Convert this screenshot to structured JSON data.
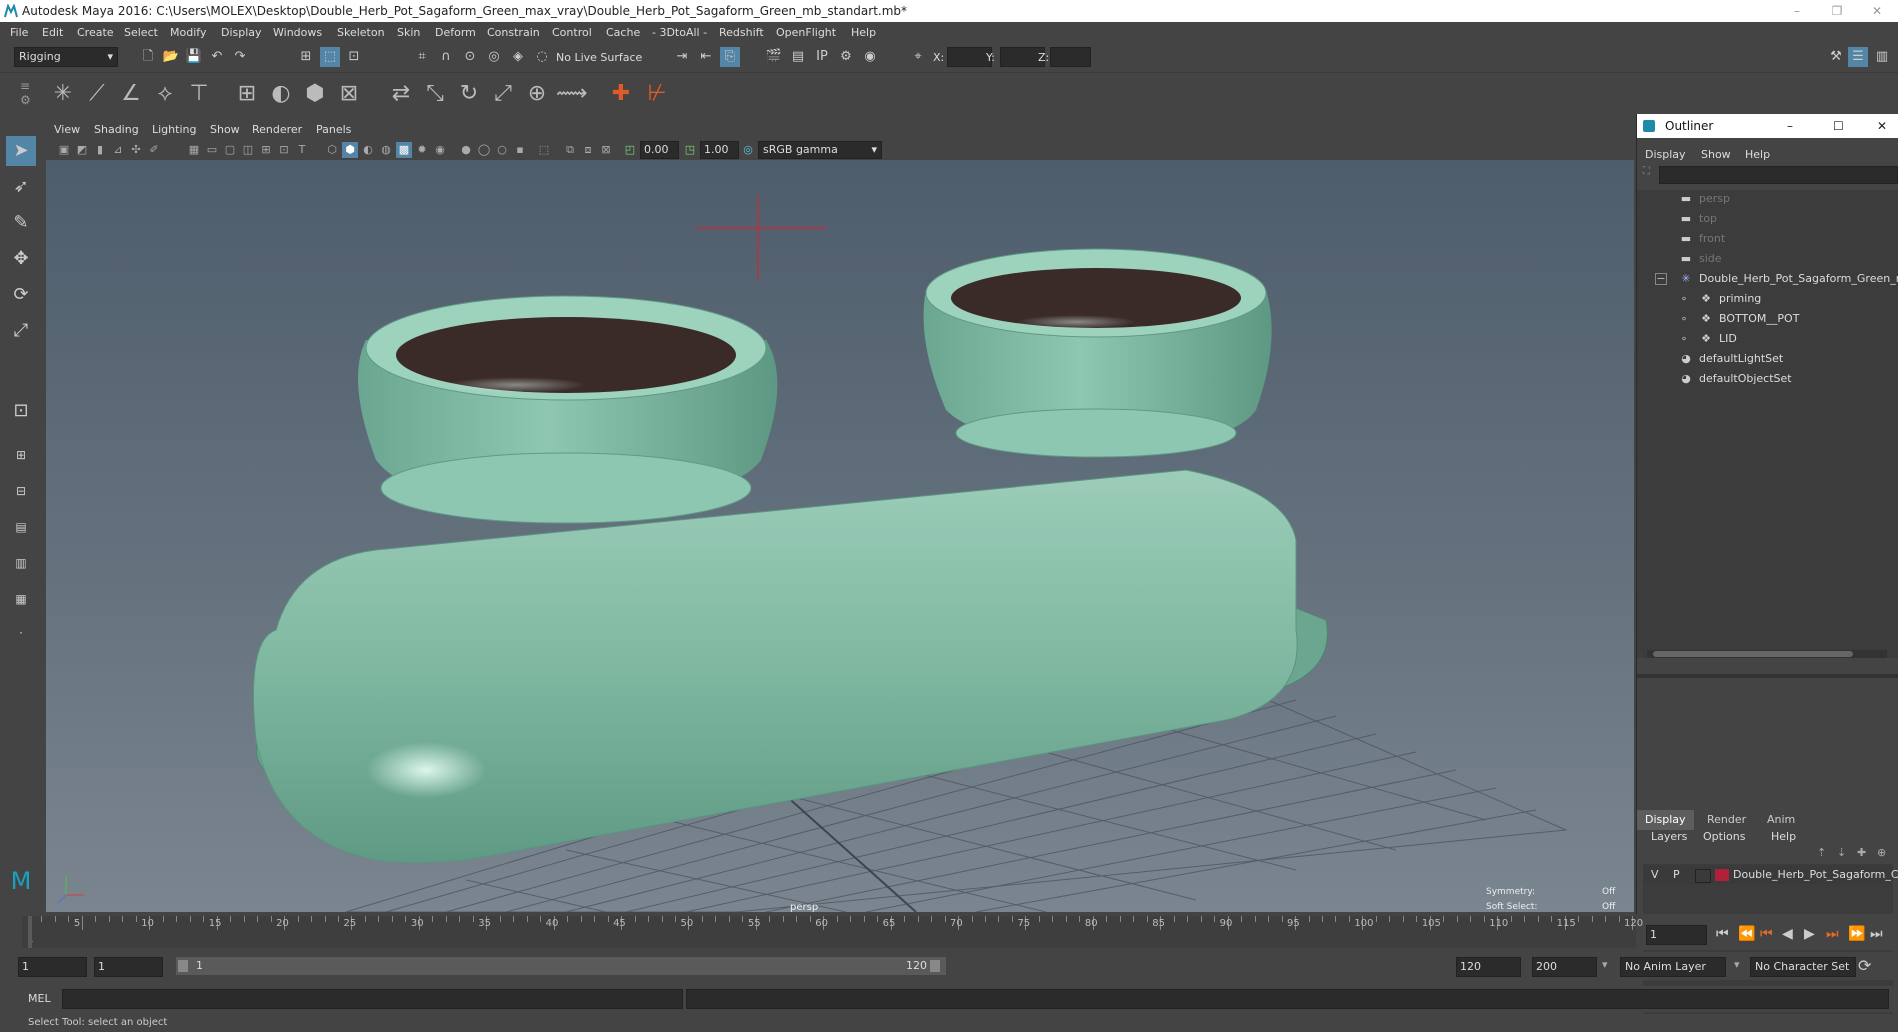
{
  "window": {
    "title": "Autodesk Maya 2016: C:\\Users\\MOLEX\\Desktop\\Double_Herb_Pot_Sagaform_Green_max_vray\\Double_Herb_Pot_Sagaform_Green_mb_standart.mb*",
    "minimize": "–",
    "restore": "❐",
    "close": "✕"
  },
  "menubar": [
    "File",
    "Edit",
    "Create",
    "Select",
    "Modify",
    "Display",
    "Windows",
    "Skeleton",
    "Skin",
    "Deform",
    "Constrain",
    "Control",
    "Cache",
    "- 3DtoAll -",
    "Redshift",
    "OpenFlight",
    "Help"
  ],
  "statusline": {
    "mode": "Rigging",
    "live_surface": "No Live Surface",
    "x_label": "X:",
    "y_label": "Y:",
    "z_label": "Z:"
  },
  "viewport": {
    "menus": [
      "View",
      "Shading",
      "Lighting",
      "Show",
      "Renderer",
      "Panels"
    ],
    "exposure": "0.00",
    "gamma": "1.00",
    "colorspace": "sRGB gamma",
    "camera_label": "persp",
    "symmetry_label": "Symmetry:",
    "symmetry_value": "Off",
    "soft_select_label": "Soft Select:",
    "soft_select_value": "Off"
  },
  "outliner": {
    "title": "Outliner",
    "menus": [
      "Display",
      "Show",
      "Help"
    ],
    "items": [
      {
        "label": "persp",
        "icon": "camera-icon",
        "indent": 0,
        "dim": true
      },
      {
        "label": "top",
        "icon": "camera-icon",
        "indent": 0,
        "dim": true
      },
      {
        "label": "front",
        "icon": "camera-icon",
        "indent": 0,
        "dim": true
      },
      {
        "label": "side",
        "icon": "camera-icon",
        "indent": 0,
        "dim": true
      },
      {
        "label": "Double_Herb_Pot_Sagaform_Green_r",
        "icon": "group-icon",
        "indent": 0,
        "dim": false,
        "expanded": true
      },
      {
        "label": "priming",
        "icon": "mesh-icon",
        "indent": 1,
        "dim": false
      },
      {
        "label": "BOTTOM__POT",
        "icon": "mesh-icon",
        "indent": 1,
        "dim": false
      },
      {
        "label": "LID",
        "icon": "mesh-icon",
        "indent": 1,
        "dim": false
      },
      {
        "label": "defaultLightSet",
        "icon": "set-icon",
        "indent": 0,
        "dim": false
      },
      {
        "label": "defaultObjectSet",
        "icon": "set-icon",
        "indent": 0,
        "dim": false
      }
    ]
  },
  "layer_editor": {
    "tabs": [
      "Display",
      "Render",
      "Anim"
    ],
    "menus": [
      "Layers",
      "Options",
      "Help"
    ],
    "layer": {
      "v": "V",
      "p": "P",
      "name": "Double_Herb_Pot_Sagaform_C",
      "color": "#b0203a"
    }
  },
  "timeline": {
    "labels": [
      "5",
      "10",
      "15",
      "20",
      "25",
      "30",
      "35",
      "40",
      "45",
      "50",
      "55",
      "60",
      "65",
      "70",
      "75",
      "80",
      "85",
      "90",
      "95",
      "100",
      "105",
      "110",
      "115",
      "120"
    ],
    "current_frame_label": "1",
    "current_frame": "1"
  },
  "range": {
    "start": "1",
    "playback_start": "1",
    "slider_start": "1",
    "slider_end": "120",
    "playback_end": "120",
    "end": "200",
    "anim_layer": "No Anim Layer",
    "character_set": "No Character Set"
  },
  "commandline": {
    "label": "MEL"
  },
  "helpline": "Select Tool: select an object",
  "colors": {
    "accent": "#5285a6",
    "pot": "#7fb8a1",
    "soil": "#3a2a28"
  }
}
